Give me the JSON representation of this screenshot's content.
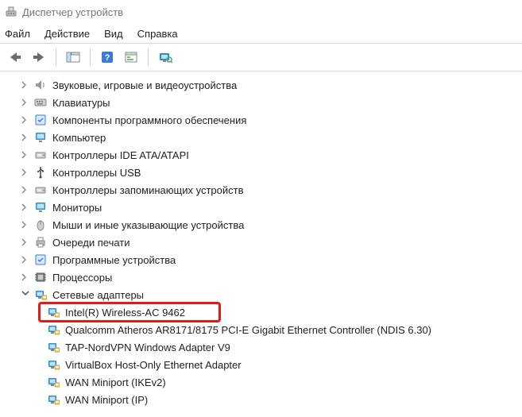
{
  "window": {
    "title": "Диспетчер устройств"
  },
  "menu": {
    "file": "Файл",
    "action": "Действие",
    "view": "Вид",
    "help": "Справка"
  },
  "tree": {
    "sound": {
      "label": "Звуковые, игровые и видеоустройства"
    },
    "keyboards": {
      "label": "Клавиатуры"
    },
    "software": {
      "label": "Компоненты программного обеспечения"
    },
    "computer": {
      "label": "Компьютер"
    },
    "ide": {
      "label": "Контроллеры IDE ATA/ATAPI"
    },
    "usb": {
      "label": "Контроллеры USB"
    },
    "storage": {
      "label": "Контроллеры запоминающих устройств"
    },
    "monitors": {
      "label": "Мониторы"
    },
    "mice": {
      "label": "Мыши и иные указывающие устройства"
    },
    "printq": {
      "label": "Очереди печати"
    },
    "swdev": {
      "label": "Программные устройства"
    },
    "cpu": {
      "label": "Процессоры"
    },
    "netadapters": {
      "label": "Сетевые адаптеры"
    },
    "net_intel": {
      "label": "Intel(R) Wireless-AC 9462"
    },
    "net_qca": {
      "label": "Qualcomm Atheros AR8171/8175 PCI-E Gigabit Ethernet Controller (NDIS 6.30)"
    },
    "net_tap": {
      "label": "TAP-NordVPN Windows Adapter V9"
    },
    "net_vbox": {
      "label": "VirtualBox Host-Only Ethernet Adapter"
    },
    "net_wan1": {
      "label": "WAN Miniport (IKEv2)"
    },
    "net_wan2": {
      "label": "WAN Miniport (IP)"
    }
  }
}
